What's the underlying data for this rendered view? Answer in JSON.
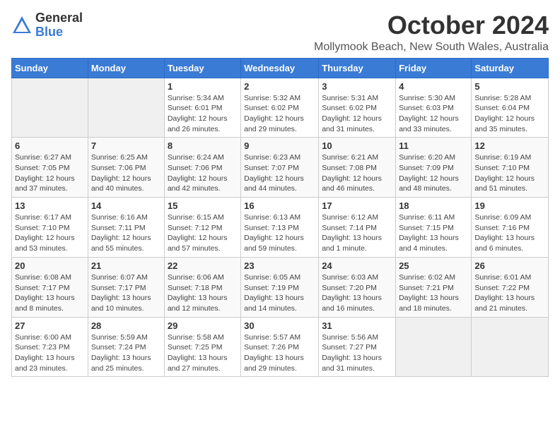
{
  "logo": {
    "general": "General",
    "blue": "Blue"
  },
  "title": "October 2024",
  "location": "Mollymook Beach, New South Wales, Australia",
  "days_of_week": [
    "Sunday",
    "Monday",
    "Tuesday",
    "Wednesday",
    "Thursday",
    "Friday",
    "Saturday"
  ],
  "weeks": [
    [
      {
        "day": "",
        "info": ""
      },
      {
        "day": "",
        "info": ""
      },
      {
        "day": "1",
        "info": "Sunrise: 5:34 AM\nSunset: 6:01 PM\nDaylight: 12 hours\nand 26 minutes."
      },
      {
        "day": "2",
        "info": "Sunrise: 5:32 AM\nSunset: 6:02 PM\nDaylight: 12 hours\nand 29 minutes."
      },
      {
        "day": "3",
        "info": "Sunrise: 5:31 AM\nSunset: 6:02 PM\nDaylight: 12 hours\nand 31 minutes."
      },
      {
        "day": "4",
        "info": "Sunrise: 5:30 AM\nSunset: 6:03 PM\nDaylight: 12 hours\nand 33 minutes."
      },
      {
        "day": "5",
        "info": "Sunrise: 5:28 AM\nSunset: 6:04 PM\nDaylight: 12 hours\nand 35 minutes."
      }
    ],
    [
      {
        "day": "6",
        "info": "Sunrise: 6:27 AM\nSunset: 7:05 PM\nDaylight: 12 hours\nand 37 minutes."
      },
      {
        "day": "7",
        "info": "Sunrise: 6:25 AM\nSunset: 7:06 PM\nDaylight: 12 hours\nand 40 minutes."
      },
      {
        "day": "8",
        "info": "Sunrise: 6:24 AM\nSunset: 7:06 PM\nDaylight: 12 hours\nand 42 minutes."
      },
      {
        "day": "9",
        "info": "Sunrise: 6:23 AM\nSunset: 7:07 PM\nDaylight: 12 hours\nand 44 minutes."
      },
      {
        "day": "10",
        "info": "Sunrise: 6:21 AM\nSunset: 7:08 PM\nDaylight: 12 hours\nand 46 minutes."
      },
      {
        "day": "11",
        "info": "Sunrise: 6:20 AM\nSunset: 7:09 PM\nDaylight: 12 hours\nand 48 minutes."
      },
      {
        "day": "12",
        "info": "Sunrise: 6:19 AM\nSunset: 7:10 PM\nDaylight: 12 hours\nand 51 minutes."
      }
    ],
    [
      {
        "day": "13",
        "info": "Sunrise: 6:17 AM\nSunset: 7:10 PM\nDaylight: 12 hours\nand 53 minutes."
      },
      {
        "day": "14",
        "info": "Sunrise: 6:16 AM\nSunset: 7:11 PM\nDaylight: 12 hours\nand 55 minutes."
      },
      {
        "day": "15",
        "info": "Sunrise: 6:15 AM\nSunset: 7:12 PM\nDaylight: 12 hours\nand 57 minutes."
      },
      {
        "day": "16",
        "info": "Sunrise: 6:13 AM\nSunset: 7:13 PM\nDaylight: 12 hours\nand 59 minutes."
      },
      {
        "day": "17",
        "info": "Sunrise: 6:12 AM\nSunset: 7:14 PM\nDaylight: 13 hours\nand 1 minute."
      },
      {
        "day": "18",
        "info": "Sunrise: 6:11 AM\nSunset: 7:15 PM\nDaylight: 13 hours\nand 4 minutes."
      },
      {
        "day": "19",
        "info": "Sunrise: 6:09 AM\nSunset: 7:16 PM\nDaylight: 13 hours\nand 6 minutes."
      }
    ],
    [
      {
        "day": "20",
        "info": "Sunrise: 6:08 AM\nSunset: 7:17 PM\nDaylight: 13 hours\nand 8 minutes."
      },
      {
        "day": "21",
        "info": "Sunrise: 6:07 AM\nSunset: 7:17 PM\nDaylight: 13 hours\nand 10 minutes."
      },
      {
        "day": "22",
        "info": "Sunrise: 6:06 AM\nSunset: 7:18 PM\nDaylight: 13 hours\nand 12 minutes."
      },
      {
        "day": "23",
        "info": "Sunrise: 6:05 AM\nSunset: 7:19 PM\nDaylight: 13 hours\nand 14 minutes."
      },
      {
        "day": "24",
        "info": "Sunrise: 6:03 AM\nSunset: 7:20 PM\nDaylight: 13 hours\nand 16 minutes."
      },
      {
        "day": "25",
        "info": "Sunrise: 6:02 AM\nSunset: 7:21 PM\nDaylight: 13 hours\nand 18 minutes."
      },
      {
        "day": "26",
        "info": "Sunrise: 6:01 AM\nSunset: 7:22 PM\nDaylight: 13 hours\nand 21 minutes."
      }
    ],
    [
      {
        "day": "27",
        "info": "Sunrise: 6:00 AM\nSunset: 7:23 PM\nDaylight: 13 hours\nand 23 minutes."
      },
      {
        "day": "28",
        "info": "Sunrise: 5:59 AM\nSunset: 7:24 PM\nDaylight: 13 hours\nand 25 minutes."
      },
      {
        "day": "29",
        "info": "Sunrise: 5:58 AM\nSunset: 7:25 PM\nDaylight: 13 hours\nand 27 minutes."
      },
      {
        "day": "30",
        "info": "Sunrise: 5:57 AM\nSunset: 7:26 PM\nDaylight: 13 hours\nand 29 minutes."
      },
      {
        "day": "31",
        "info": "Sunrise: 5:56 AM\nSunset: 7:27 PM\nDaylight: 13 hours\nand 31 minutes."
      },
      {
        "day": "",
        "info": ""
      },
      {
        "day": "",
        "info": ""
      }
    ]
  ]
}
